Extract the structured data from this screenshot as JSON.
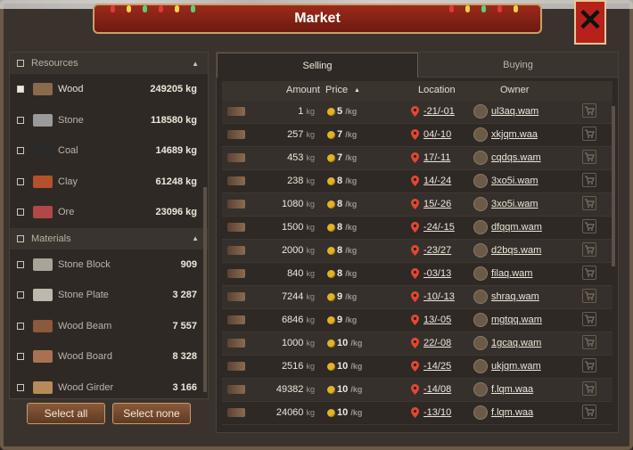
{
  "window": {
    "title": "Market",
    "close": "✕"
  },
  "left": {
    "sections": [
      {
        "title": "Resources",
        "items": [
          {
            "name": "Wood",
            "amount": "249205 kg",
            "checked": true,
            "color": "#8a6a4c"
          },
          {
            "name": "Stone",
            "amount": "118580 kg",
            "checked": false,
            "color": "#9a9a9a"
          },
          {
            "name": "Coal",
            "amount": "14689 kg",
            "checked": false,
            "color": "#2a2a2a"
          },
          {
            "name": "Clay",
            "amount": "61248 kg",
            "checked": false,
            "color": "#b4512c"
          },
          {
            "name": "Ore",
            "amount": "23096 kg",
            "checked": false,
            "color": "#b04848"
          }
        ]
      },
      {
        "title": "Materials",
        "items": [
          {
            "name": "Stone Block",
            "amount": "909",
            "checked": false,
            "color": "#a9a39a"
          },
          {
            "name": "Stone Plate",
            "amount": "3 287",
            "checked": false,
            "color": "#bdb7ad"
          },
          {
            "name": "Wood Beam",
            "amount": "7 557",
            "checked": false,
            "color": "#8a5a3a"
          },
          {
            "name": "Wood Board",
            "amount": "8 328",
            "checked": false,
            "color": "#a87250"
          },
          {
            "name": "Wood Girder",
            "amount": "3 166",
            "checked": false,
            "color": "#b88a5a"
          }
        ]
      }
    ],
    "select_all": "Select all",
    "select_none": "Select none"
  },
  "tabs": {
    "selling": "Selling",
    "buying": "Buying"
  },
  "table": {
    "headers": {
      "amount": "Amount",
      "price": "Price",
      "sort": "▲",
      "location": "Location",
      "owner": "Owner"
    },
    "unit_kg": "kg",
    "unit_price": "/kg",
    "rows": [
      {
        "amount": "1",
        "price": "5",
        "location": "-21/-01",
        "owner": "ul3aq.wam"
      },
      {
        "amount": "257",
        "price": "7",
        "location": "04/-10",
        "owner": "xkjqm.waa"
      },
      {
        "amount": "453",
        "price": "7",
        "location": "17/-11",
        "owner": "cqdqs.wam"
      },
      {
        "amount": "238",
        "price": "8",
        "location": "14/-24",
        "owner": "3xo5i.wam"
      },
      {
        "amount": "1080",
        "price": "8",
        "location": "15/-26",
        "owner": "3xo5i.wam"
      },
      {
        "amount": "1500",
        "price": "8",
        "location": "-24/-15",
        "owner": "dfqqm.wam"
      },
      {
        "amount": "2000",
        "price": "8",
        "location": "-23/27",
        "owner": "d2bqs.wam"
      },
      {
        "amount": "840",
        "price": "8",
        "location": "-03/13",
        "owner": "filaq.wam"
      },
      {
        "amount": "7244",
        "price": "9",
        "location": "-10/-13",
        "owner": "shraq.wam"
      },
      {
        "amount": "6846",
        "price": "9",
        "location": "13/-05",
        "owner": "mgtqq.wam"
      },
      {
        "amount": "1000",
        "price": "10",
        "location": "22/-08",
        "owner": "1gcaq.wam"
      },
      {
        "amount": "2516",
        "price": "10",
        "location": "-14/25",
        "owner": "ukjqm.wam"
      },
      {
        "amount": "49382",
        "price": "10",
        "location": "-14/08",
        "owner": "f.lqm.waa"
      },
      {
        "amount": "24060",
        "price": "10",
        "location": "-13/10",
        "owner": "f.lqm.waa"
      }
    ]
  }
}
